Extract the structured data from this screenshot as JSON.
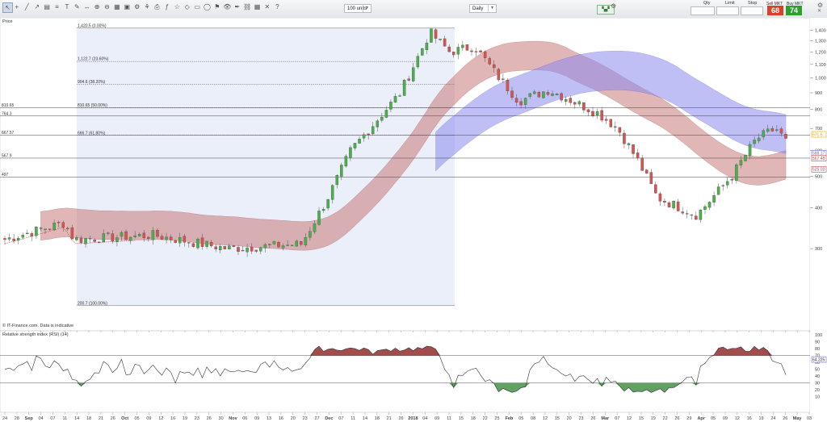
{
  "toolbar": {
    "icons": [
      "cursor-icon",
      "crosshair-icon",
      "line-icon",
      "ray-icon",
      "channel-icon",
      "fib-icon",
      "text-icon",
      "pencil-icon",
      "arrows-icon",
      "zoom-in-icon",
      "zoom-out-icon",
      "calendar-icon",
      "save-icon",
      "settings-icon",
      "brush-icon",
      "print-icon",
      "indicator-icon",
      "star-icon",
      "shape-icon",
      "rect-icon",
      "ellipse-icon",
      "flag-icon",
      "eye-icon",
      "pen-icon",
      "chain-icon",
      "grid-icon",
      "cross-icon",
      "question-icon"
    ],
    "units_select": "100 units",
    "timeframe_select": "Daily",
    "trade": {
      "qty_label": "Qty",
      "limit_label": "Limit",
      "stop_label": "Stop",
      "sell_label": "Sell MKT",
      "buy_label": "Buy MKT",
      "sell_price": "68",
      "buy_price": "74",
      "sell_color": "#d9412d",
      "buy_color": "#2ea02e"
    }
  },
  "chart_data": {
    "type": "candlestick",
    "panels": [
      {
        "title": "Price",
        "watermark": "© IT-Finance.com. Data is indicative",
        "y_ticks": [
          300,
          400,
          500,
          600,
          700,
          800,
          900,
          1000,
          1100,
          1200,
          1300,
          1400
        ],
        "y_tick_labels": [
          "300",
          "400",
          "500",
          "600",
          "700",
          "800",
          "900",
          "1,000",
          "1,100",
          "1,200",
          "1,300",
          "1,400"
        ],
        "ylim": [
          170,
          1460
        ],
        "x_tick_labels": [
          "24",
          "28",
          "Sep",
          "04",
          "07",
          "11",
          "14",
          "18",
          "21",
          "26",
          "Oct",
          "05",
          "09",
          "12",
          "16",
          "19",
          "23",
          "26",
          "30",
          "Nov",
          "06",
          "09",
          "13",
          "16",
          "20",
          "23",
          "27",
          "Dec",
          "07",
          "11",
          "14",
          "18",
          "21",
          "26",
          "2018",
          "04",
          "09",
          "11",
          "15",
          "18",
          "22",
          "25",
          "Feb",
          "05",
          "08",
          "12",
          "15",
          "20",
          "23",
          "26",
          "Mar",
          "07",
          "12",
          "15",
          "19",
          "22",
          "26",
          "29",
          "Apr",
          "05",
          "09",
          "12",
          "16",
          "19",
          "24",
          "26",
          "May",
          "03"
        ],
        "x_tick_count": 68,
        "up_color": "#4bb04b",
        "down_color": "#d9534f",
        "candle_count": 175,
        "candles_ohlc_mid_to_close": {
          "note_first": "first segment",
          "anchors": [
            [
              0,
              320
            ],
            [
              12,
              360
            ],
            [
              14,
              320
            ],
            [
              30,
              330
            ],
            [
              45,
              300
            ],
            [
              60,
              310
            ],
            [
              65,
              420
            ],
            [
              70,
              600
            ],
            [
              80,
              900
            ],
            [
              86,
              1380
            ],
            [
              90,
              1200
            ],
            [
              95,
              1250
            ],
            [
              100,
              1000
            ],
            [
              104,
              850
            ],
            [
              110,
              920
            ],
            [
              120,
              780
            ],
            [
              124,
              700
            ],
            [
              128,
              560
            ],
            [
              132,
              430
            ],
            [
              140,
              380
            ],
            [
              147,
              500
            ],
            [
              152,
              650
            ],
            [
              156,
              700
            ],
            [
              158,
              640
            ]
          ]
        },
        "fib_levels": [
          {
            "label": "1,420.5 (0.00%)",
            "value": 1420.5
          },
          {
            "label": "1,122.7 (23.60%)",
            "value": 1122.7
          },
          {
            "label": "904.6 (38.20%)",
            "value": 954.6
          },
          {
            "label": "810.65 (50.00%)",
            "value": 810.65
          },
          {
            "label": "666.7 (61.80%)",
            "value": 666.7
          },
          {
            "label": "200.7 (100.00%)",
            "value": 200.7
          }
        ],
        "hlines": [
          {
            "label": "810.65",
            "value": 810.65
          },
          {
            "label": "764.3",
            "value": 764.3
          },
          {
            "label": "667.57",
            "value": 667.57
          },
          {
            "label": "567.9",
            "value": 567.9
          },
          {
            "label": "497",
            "value": 497
          }
        ],
        "price_tags": [
          {
            "label": "671.6",
            "value": 671.6,
            "color": "#e8a800"
          },
          {
            "label": "588.17",
            "value": 588.17,
            "color": "#6a6fce"
          },
          {
            "label": "567.48",
            "value": 567.48,
            "color": "#c04a4a"
          },
          {
            "label": "525.02",
            "value": 525.02,
            "color": "#c04a4a"
          }
        ]
      },
      {
        "title": "Relative strength index (RSI) (14)",
        "y_ticks": [
          10,
          20,
          30,
          40,
          50,
          60,
          70,
          80,
          90,
          100
        ],
        "y_tick_labels": [
          "10",
          "20",
          "30",
          "40",
          "50",
          "60",
          "70",
          "80",
          "90",
          "100"
        ],
        "ylim": [
          0,
          105
        ],
        "levels": [
          70,
          30
        ],
        "price_tags": [
          {
            "label": "64.225",
            "value": 64.225
          }
        ]
      }
    ]
  }
}
